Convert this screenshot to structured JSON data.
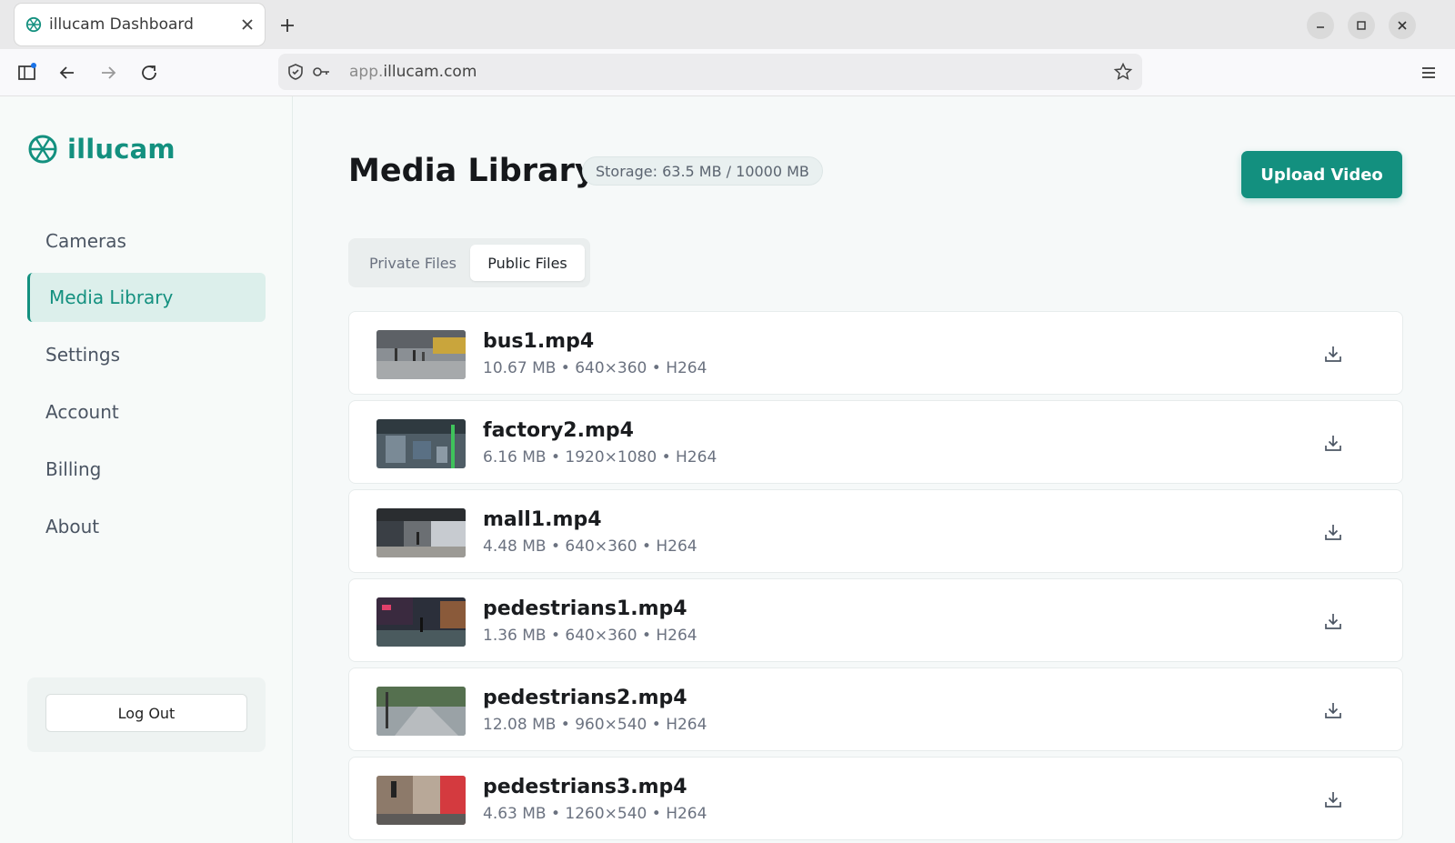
{
  "browser": {
    "tab_title": "illucam Dashboard",
    "url_prefix": "app.",
    "url_domain": "illucam.com"
  },
  "sidebar": {
    "brand": "illucam",
    "items": [
      {
        "label": "Cameras"
      },
      {
        "label": "Media Library"
      },
      {
        "label": "Settings"
      },
      {
        "label": "Account"
      },
      {
        "label": "Billing"
      },
      {
        "label": "About"
      }
    ],
    "logout_label": "Log Out"
  },
  "main": {
    "title": "Media Library",
    "storage": "Storage: 63.5 MB / 10000 MB",
    "upload_label": "Upload Video",
    "tabs": [
      {
        "label": "Private Files"
      },
      {
        "label": "Public Files"
      }
    ],
    "files": [
      {
        "name": "bus1.mp4",
        "meta": "10.67 MB • 640×360 • H264"
      },
      {
        "name": "factory2.mp4",
        "meta": "6.16 MB • 1920×1080 • H264"
      },
      {
        "name": "mall1.mp4",
        "meta": "4.48 MB • 640×360 • H264"
      },
      {
        "name": "pedestrians1.mp4",
        "meta": "1.36 MB • 640×360 • H264"
      },
      {
        "name": "pedestrians2.mp4",
        "meta": "12.08 MB • 960×540 • H264"
      },
      {
        "name": "pedestrians3.mp4",
        "meta": "4.63 MB • 1260×540 • H264"
      }
    ]
  },
  "colors": {
    "accent": "#13907f",
    "active_bg": "#dcefeb"
  },
  "icons": {
    "favicon": "illucam-logo-icon",
    "download": "download-icon",
    "bookmark": "star-icon",
    "menu": "hamburger-menu-icon"
  }
}
